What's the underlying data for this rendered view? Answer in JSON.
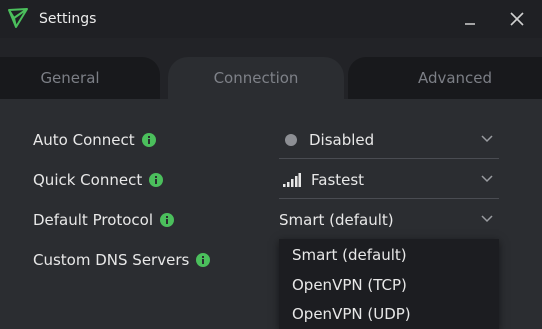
{
  "window": {
    "title": "Settings",
    "accent": "#4bbf5c"
  },
  "tabs": [
    {
      "label": "General",
      "active": false
    },
    {
      "label": "Connection",
      "active": true
    },
    {
      "label": "Advanced",
      "active": false
    }
  ],
  "settings": {
    "auto_connect": {
      "label": "Auto Connect",
      "value": "Disabled"
    },
    "quick_connect": {
      "label": "Quick Connect",
      "value": "Fastest"
    },
    "default_protocol": {
      "label": "Default Protocol",
      "value": "Smart (default)"
    },
    "custom_dns": {
      "label": "Custom DNS Servers"
    }
  },
  "protocol_dropdown": {
    "options": [
      "Smart (default)",
      "OpenVPN (TCP)",
      "OpenVPN (UDP)"
    ]
  },
  "icons": {
    "app": "protonvpn-triangle-icon",
    "info": "info-icon",
    "minimize": "minimize-icon",
    "close": "close-icon",
    "chevron": "chevron-down-icon",
    "status_dot": "status-dot-icon",
    "signal": "signal-bars-icon"
  }
}
